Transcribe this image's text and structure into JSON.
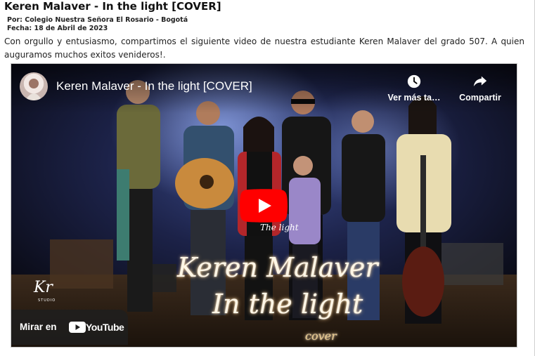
{
  "article": {
    "title": "Keren Malaver - In the light [COVER]",
    "byline": "Por: Colegio Nuestra Señora El Rosario - Bogotá",
    "date": "Fecha: 18 de Abril de 2023",
    "body": "Con orgullo y entusiasmo, compartimos el siguiente video de nuestra estudiante Keren Malaver del grado 507. A quien auguramos muchos exitos venideros!."
  },
  "video": {
    "title": "Keren Malaver - In the light [COVER]",
    "watch_later_label": "Ver más ta…",
    "share_label": "Compartir",
    "watch_on_label": "Mirar en",
    "youtube_wordmark": "YouTube",
    "thumbnail_text": {
      "artist": "Keren Malaver",
      "song": "In the light",
      "cover": "cover",
      "shirt": "The light",
      "studio_mark": "Kr",
      "studio_sub": "STUDIO"
    },
    "icons": {
      "watch_later": "clock-icon",
      "share": "share-arrow-icon",
      "play": "play-button-icon",
      "youtube": "youtube-logo-icon"
    },
    "colors": {
      "youtube_red": "#ff0000",
      "overlay_dark": "#1e1e1e"
    }
  }
}
